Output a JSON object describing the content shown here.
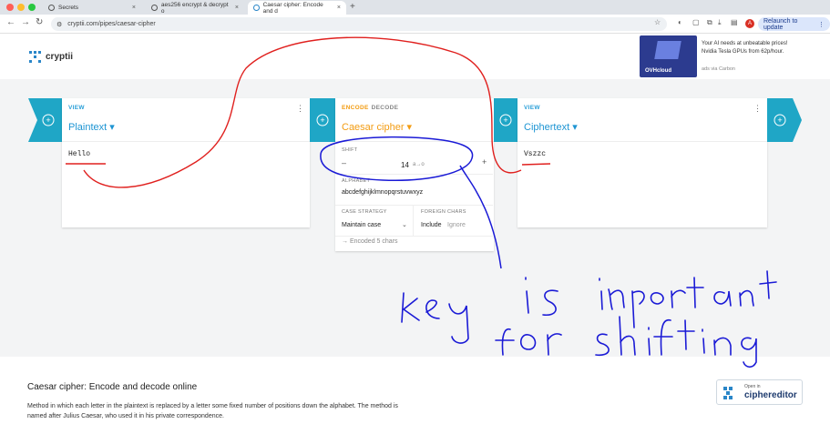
{
  "browser": {
    "tabs": [
      {
        "label": "Secrets"
      },
      {
        "label": "aes256 encrypt & decrypt o"
      },
      {
        "label": "Caesar cipher: Encode and d"
      }
    ],
    "url": "cryptii.com/pipes/caesar-cipher",
    "relaunch_label": "Relaunch to update",
    "avatar_letter": "A"
  },
  "header": {
    "logo_text": "cryptii",
    "ad": {
      "text": "Your AI needs at unbeatable prices! Nvidia Tesla GPUs from 62p/hour.",
      "brand": "OVHcloud",
      "via": "ads via Carbon"
    }
  },
  "cards": {
    "plaintext": {
      "kind": "VIEW",
      "title": "Plaintext ▾",
      "content": "Hello"
    },
    "encoder": {
      "kind_encode": "ENCODE",
      "kind_decode": "DECODE",
      "title": "Caesar cipher ▾",
      "shift_label": "SHIFT",
      "shift_value": "14",
      "shift_map": "a→o",
      "alphabet_label": "ALPHABET",
      "alphabet_value": "abcdefghijklmnopqrstuvwxyz",
      "case_label": "CASE STRATEGY",
      "case_value": "Maintain case",
      "foreign_label": "FOREIGN CHARS",
      "foreign_include": "Include",
      "foreign_ignore": "Ignore",
      "status": "Encoded 5 chars"
    },
    "ciphertext": {
      "kind": "VIEW",
      "title": "Ciphertext ▾",
      "content": "Vszzc"
    }
  },
  "description": {
    "title": "Caesar cipher: Encode and decode online",
    "text": "Method in which each letter in the plaintext is replaced by a letter some fixed number of positions down the alphabet. The method is named after Julius Caesar, who used it in his private correspondence.",
    "open_in": "Open in",
    "editor_name": "ciphereditor"
  },
  "colors": {
    "accent": "#1fa6c6",
    "encoder": "#f39c12",
    "annotation_red": "#e0201e",
    "annotation_blue": "#1a1ad6"
  }
}
